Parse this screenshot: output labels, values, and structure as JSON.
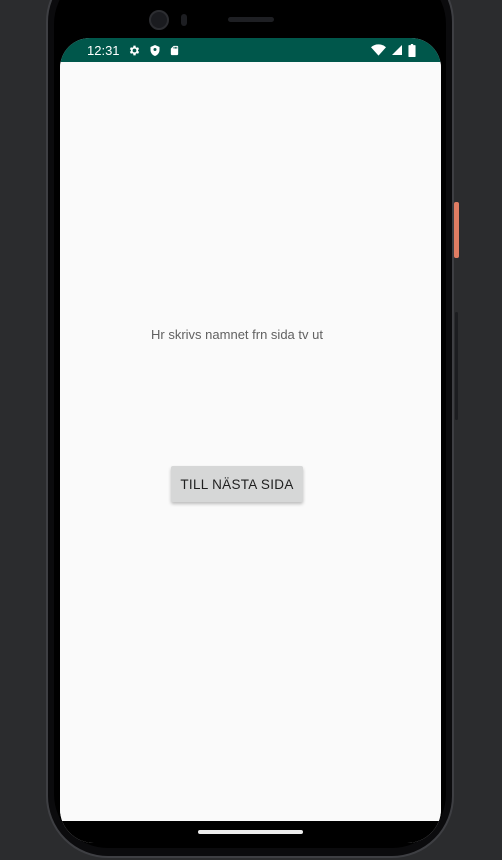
{
  "status_bar": {
    "time": "12:31",
    "background_color": "#00574b",
    "left_icons": [
      "gear-icon",
      "shield-icon",
      "sd-card-icon"
    ],
    "right_icons": [
      "wifi-icon",
      "cell-signal-icon",
      "battery-icon"
    ]
  },
  "main": {
    "label_text": "Hr skrivs namnet frn sida tv ut",
    "button_label": "TILL NÄSTA SIDA"
  },
  "colors": {
    "screen_background": "#fafafa",
    "button_background": "#d6d7d7",
    "side_button_accent": "#e07d63"
  }
}
